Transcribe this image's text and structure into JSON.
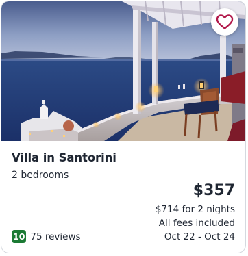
{
  "listing": {
    "title": "Villa in Santorini",
    "subtitle": "2 bedrooms",
    "price": "$357",
    "price_total": "$714 for 2 nights",
    "fees_note": "All fees included",
    "dates": "Oct 22 - Oct 24"
  },
  "rating": {
    "score": "10",
    "reviews": "75 reviews"
  },
  "favorite": {
    "icon": "heart-outline-icon",
    "saved": false
  },
  "colors": {
    "heart": "#b1184a",
    "rating_badge": "#1b7a34",
    "text": "#1f2632"
  }
}
